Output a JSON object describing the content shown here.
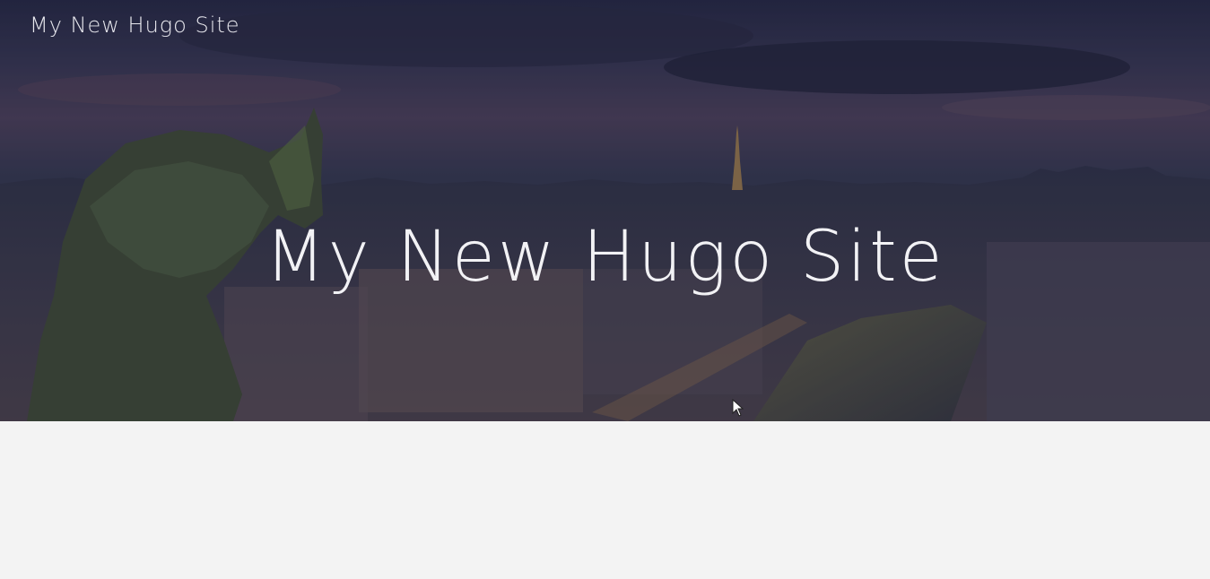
{
  "header": {
    "site_title": "My New Hugo Site"
  },
  "hero": {
    "heading": "My New Hugo Site",
    "overlay_color": "#1e1e3a"
  },
  "page": {
    "background": "#f3f3f3"
  }
}
